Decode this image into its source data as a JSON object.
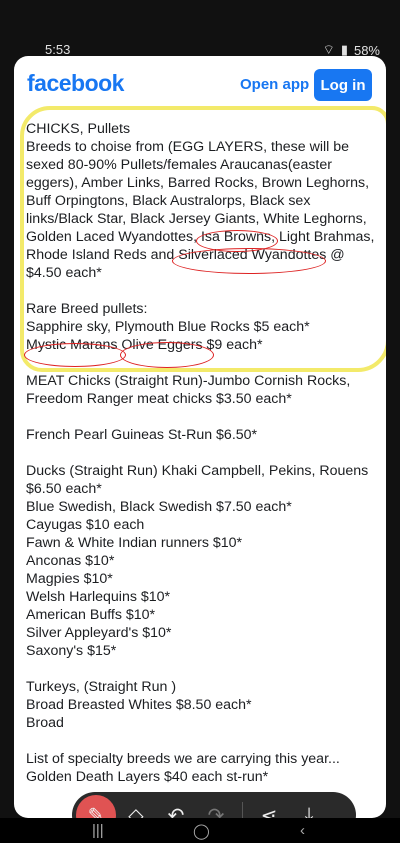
{
  "status": {
    "time": "5:53",
    "battery": "58%"
  },
  "header": {
    "logo": "facebook",
    "open_app": "Open app",
    "login": "Log in"
  },
  "post_lines": [
    "CHICKS, Pullets",
    "Breeds to choise from (EGG LAYERS, these will be sexed 80-90%  Pullets/females Araucanas(easter eggers), Amber Links, Barred Rocks, Brown Leghorns, Buff Orpingtons, Black Australorps, Black sex links/Black Star, Black Jersey Giants, White Leghorns, Golden Laced Wyandottes, Isa Browns, Light Brahmas, Rhode Island Reds and Silverlaced Wyandottes @ $4.50 each*",
    "",
    "Rare Breed pullets:",
    "Sapphire sky, Plymouth Blue Rocks $5 each*",
    "Mystic Marans Olive Eggers  $9 each*",
    "",
    "MEAT Chicks (Straight Run)-Jumbo Cornish Rocks, Freedom Ranger meat chicks $3.50 each*",
    "",
    "French Pearl Guineas St-Run $6.50*",
    "",
    "Ducks (Straight Run) Khaki Campbell, Pekins, Rouens $6.50 each*",
    "Blue Swedish, Black Swedish $7.50 each*",
    "Cayugas $10 each",
    "Fawn & White Indian runners $10*",
    "Anconas $10*",
    " Magpies $10*",
    "Welsh Harlequins $10*",
    "American Buffs $10*",
    "Silver Appleyard's $10*",
    "Saxony's $15*",
    "",
    "Turkeys, (Straight Run )",
    "Broad Breasted Whites $8.50 each*",
    "Broad",
    "",
    "List of specialty breeds we are carrying this year...",
    "Golden Death Layers $40 each st-run*"
  ],
  "toolbar": {
    "pen": "✎",
    "eraser": "◇",
    "undo": "↶",
    "redo": "↷",
    "share": "⋖",
    "save": "⤓"
  },
  "nav": {
    "recents": "|||",
    "home": "◯",
    "back": "‹"
  },
  "colors": {
    "brand": "#1877f2",
    "highlight": "#f3ea6a",
    "annotation": "#d22"
  }
}
